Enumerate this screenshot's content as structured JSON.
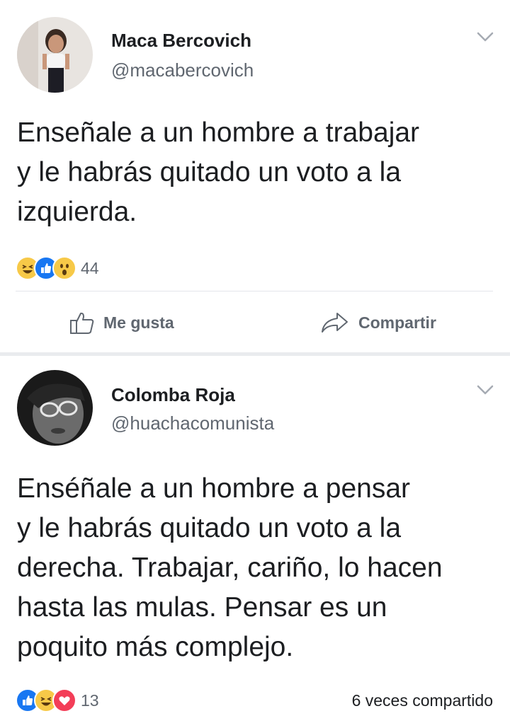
{
  "posts": [
    {
      "author": "Maca Bercovich",
      "handle": "@macabercovich",
      "text_lines": [
        "Enseñale a un hombre a trabajar",
        "y le habrás quitado un voto a la",
        "izquierda."
      ],
      "reactions": [
        "haha-icon",
        "like-icon",
        "wow-icon"
      ],
      "reaction_count": "44",
      "actions": {
        "like": "Me gusta",
        "share": "Compartir"
      }
    },
    {
      "author": "Colomba Roja",
      "handle": "@huachacomunista",
      "text_lines": [
        "Enséñale a un hombre a pensar",
        "y le habrás quitado un voto a la",
        "derecha. Trabajar, cariño, lo hacen",
        "hasta las mulas. Pensar es un",
        "poquito más complejo."
      ],
      "reactions": [
        "like-icon",
        "haha-icon",
        "love-icon"
      ],
      "reaction_count": "13",
      "shares": "6 veces compartido"
    }
  ],
  "colors": {
    "like_blue": "#1877f2",
    "haha_yellow": "#f7c948",
    "love_red": "#f33e58",
    "muted": "#606770"
  }
}
